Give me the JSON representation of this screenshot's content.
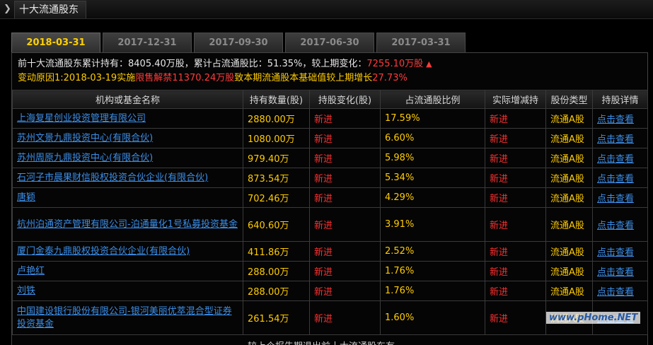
{
  "window": {
    "title": "十大流通股东"
  },
  "tabs": [
    {
      "label": "2018-03-31"
    },
    {
      "label": "2017-12-31"
    },
    {
      "label": "2017-09-30"
    },
    {
      "label": "2017-06-30"
    },
    {
      "label": "2017-03-31"
    }
  ],
  "summary": {
    "line1_prefix": "前十大流通股东累计持有：",
    "total_hold": "8405.40万股",
    "ratio_prefix": "，累计占流通股比：",
    "ratio": "51.35%",
    "change_prefix": "，较上期变化：",
    "change": "7255.10万股",
    "line2_prefix": "变动原因1:2018-03-19实施",
    "reason_highlight": "限售解禁11370.24万股",
    "line2_mid": "致本期流通股本基础值较上期增长",
    "growth": "27.73%"
  },
  "table": {
    "headers": [
      "机构或基金名称",
      "持有数量(股)",
      "持股变化(股)",
      "占流通股比例",
      "实际增减持",
      "股份类型",
      "持股详情"
    ],
    "rows": [
      {
        "name": "上海复星创业投资管理有限公司",
        "qty": "2880.00万",
        "chg": "新进",
        "ratio": "17.59%",
        "act": "新进",
        "type": "流通A股",
        "detail": "点击查看"
      },
      {
        "name": "苏州文景九鼎投资中心(有限合伙)",
        "qty": "1080.00万",
        "chg": "新进",
        "ratio": "6.60%",
        "act": "新进",
        "type": "流通A股",
        "detail": "点击查看"
      },
      {
        "name": "苏州周原九鼎投资中心(有限合伙)",
        "qty": "979.40万",
        "chg": "新进",
        "ratio": "5.98%",
        "act": "新进",
        "type": "流通A股",
        "detail": "点击查看"
      },
      {
        "name": "石河子市晨果财信股权投资合伙企业(有限合伙)",
        "qty": "873.54万",
        "chg": "新进",
        "ratio": "5.34%",
        "act": "新进",
        "type": "流通A股",
        "detail": "点击查看"
      },
      {
        "name": "唐颖",
        "qty": "702.46万",
        "chg": "新进",
        "ratio": "4.29%",
        "act": "新进",
        "type": "流通A股",
        "detail": "点击查看"
      },
      {
        "name": "杭州泊通资产管理有限公司-泊通量化1号私募投资基金",
        "qty": "640.60万",
        "chg": "新进",
        "ratio": "3.91%",
        "act": "新进",
        "type": "流通A股",
        "detail": "点击查看"
      },
      {
        "name": "厦门金泰九鼎股权投资合伙企业(有限合伙)",
        "qty": "411.86万",
        "chg": "新进",
        "ratio": "2.52%",
        "act": "新进",
        "type": "流通A股",
        "detail": "点击查看"
      },
      {
        "name": "卢艳红",
        "qty": "288.00万",
        "chg": "新进",
        "ratio": "1.76%",
        "act": "新进",
        "type": "流通A股",
        "detail": "点击查看"
      },
      {
        "name": "刘铁",
        "qty": "288.00万",
        "chg": "新进",
        "ratio": "1.76%",
        "act": "新进",
        "type": "流通A股",
        "detail": "点击查看"
      },
      {
        "name": "中国建设银行股份有限公司-银河美丽优萃混合型证券投资基金",
        "qty": "261.54万",
        "chg": "新进",
        "ratio": "1.60%",
        "act": "新进",
        "type": "流通A股",
        "detail": "点击查看"
      }
    ]
  },
  "footer": {
    "text": "较上个报告期退出前十大流通股东有"
  },
  "watermark": {
    "text": "www.pHome.NET"
  }
}
